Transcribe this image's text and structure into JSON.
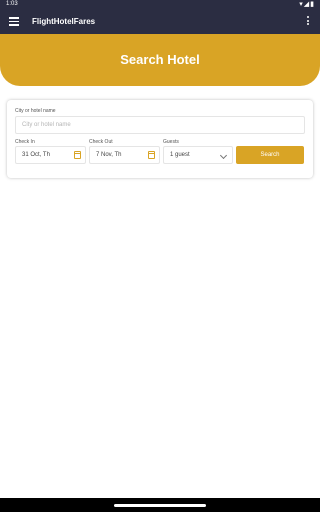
{
  "status_bar": {
    "time": "1:03",
    "icons": "▾◢▮"
  },
  "app_bar": {
    "title": "FlightHotelFares"
  },
  "banner": {
    "title": "Search Hotel"
  },
  "search_form": {
    "city_label": "City or hotel name",
    "city_placeholder": "City or hotel name",
    "checkin_label": "Check In",
    "checkin_value": "31 Oct, Th",
    "checkout_label": "Check Out",
    "checkout_value": "7 Nov, Th",
    "guests_label": "Guests",
    "guests_value": "1 guest",
    "search_label": "Search"
  },
  "colors": {
    "app_bar": "#2b2d42",
    "accent": "#d9a425"
  }
}
